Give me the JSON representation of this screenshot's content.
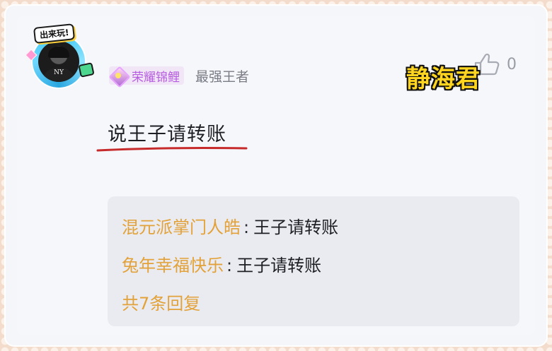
{
  "avatar": {
    "badge_text": "出来玩!",
    "shirt_text": "NY"
  },
  "user": {
    "rank_label": "荣耀锦鲤",
    "username": "最强王者"
  },
  "watermark": "静海君",
  "like": {
    "count": "0"
  },
  "comment": {
    "text": "说王子请转账"
  },
  "replies": {
    "items": [
      {
        "author": "混元派掌门人皓",
        "separator": ":",
        "text": "王子请转账"
      },
      {
        "author": "兔年幸福快乐",
        "separator": ":",
        "text": "王子请转账"
      }
    ],
    "more_label": "共7条回复"
  },
  "colors": {
    "rank": "#b65ce0",
    "reply_author": "#e2a239",
    "watermark": "#ffd51f",
    "underline": "#c62a2a"
  }
}
